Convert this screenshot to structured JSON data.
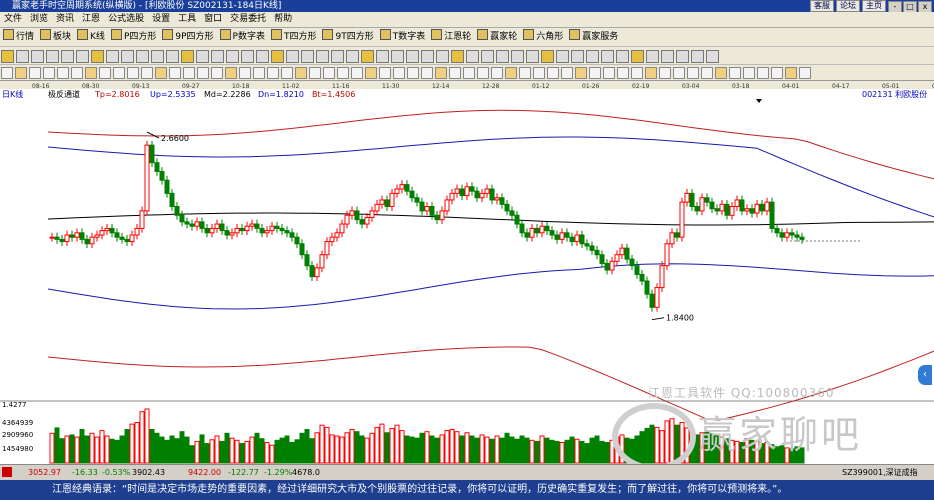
{
  "window": {
    "title": "赢家老手时空周期系统(纵横版) - [利欧股份  SZ002131-184日K线]",
    "sys_buttons": [
      "客服",
      "论坛",
      "主页"
    ],
    "controls": [
      "-",
      "□",
      "x"
    ]
  },
  "menu": [
    "文件",
    "浏览",
    "资讯",
    "江恩",
    "公式选股",
    "设置",
    "工具",
    "窗口",
    "交易委托",
    "帮助"
  ],
  "toolbar1": [
    "行情",
    "板块",
    "K线",
    "P四方形",
    "9P四方形",
    "P数字表",
    "T四方形",
    "9T四方形",
    "T数字表",
    "江恩轮",
    "赢家轮",
    "六角形",
    "赢家服务"
  ],
  "date_ticks": [
    "08-16",
    "08-30",
    "09-13",
    "09-27",
    "10-18",
    "11-02",
    "11-16",
    "11-30",
    "12-14",
    "12-28",
    "01-12",
    "01-26",
    "02-19",
    "03-04",
    "03-18",
    "04-01",
    "04-17",
    "05-01",
    "05-15"
  ],
  "chart_header": {
    "period": "日K线",
    "indicator": "极反通道",
    "tp": "Tp=2.8016",
    "up": "Up=2.5335",
    "md": "Md=2.2286",
    "dn": "Dn=1.8210",
    "bt": "Bt=1.4506",
    "stock": "002131 利欧股份"
  },
  "annotations": {
    "high": "2.6600",
    "low": "1.8400"
  },
  "volume_axis": [
    "1.4277",
    "4364939",
    "2909960",
    "1454980"
  ],
  "watermark": {
    "line1": "江恩工具软件  QQ:100800360",
    "line2": "赢家聊吧"
  },
  "status_bar": {
    "index1": "3052.97",
    "index1_change": "-16.33",
    "index1_pct": "-0.53%",
    "index1_amount": "3902.43",
    "index2": "9422.00",
    "index2_change": "-122.77",
    "index2_pct": "-1.29%",
    "index2_amount": "4678.0",
    "right": "SZ399001,深证成指"
  },
  "quote_bar": "江恩经典语录：“时间是决定市场走势的重要因素，经过详细研究大市及个别股票的过往记录，你将可以证明，历史确实重复发生；而了解过往，你将可以预测将来。”。",
  "colors": {
    "title_bg": "#1a3f9a",
    "up_candle": "#ff0000",
    "down_candle": "#008000",
    "outer_band": "#c02020",
    "inner_band": "#1818b0",
    "mid_line": "#000000"
  },
  "chart_data": {
    "type": "candlestick",
    "ylim": [
      1.4506,
      2.8016
    ],
    "closes": [
      2.18,
      2.17,
      2.16,
      2.19,
      2.18,
      2.2,
      2.17,
      2.15,
      2.18,
      2.19,
      2.21,
      2.22,
      2.2,
      2.18,
      2.17,
      2.16,
      2.19,
      2.22,
      2.3,
      2.6,
      2.52,
      2.48,
      2.44,
      2.38,
      2.32,
      2.28,
      2.25,
      2.24,
      2.23,
      2.25,
      2.22,
      2.2,
      2.22,
      2.24,
      2.21,
      2.19,
      2.2,
      2.22,
      2.21,
      2.23,
      2.24,
      2.22,
      2.2,
      2.21,
      2.23,
      2.22,
      2.21,
      2.2,
      2.18,
      2.15,
      2.1,
      2.05,
      2.0,
      2.04,
      2.1,
      2.16,
      2.18,
      2.2,
      2.24,
      2.28,
      2.3,
      2.26,
      2.24,
      2.27,
      2.3,
      2.33,
      2.35,
      2.32,
      2.38,
      2.4,
      2.42,
      2.39,
      2.36,
      2.34,
      2.3,
      2.32,
      2.28,
      2.26,
      2.3,
      2.35,
      2.38,
      2.4,
      2.37,
      2.41,
      2.39,
      2.36,
      2.38,
      2.4,
      2.35,
      2.36,
      2.33,
      2.3,
      2.28,
      2.24,
      2.2,
      2.18,
      2.22,
      2.2,
      2.23,
      2.21,
      2.19,
      2.17,
      2.2,
      2.18,
      2.16,
      2.19,
      2.15,
      2.14,
      2.12,
      2.1,
      2.06,
      2.03,
      2.07,
      2.1,
      2.13,
      2.08,
      2.05,
      2.01,
      1.98,
      1.92,
      1.86,
      1.95,
      2.05,
      2.15,
      2.2,
      2.18,
      2.34,
      2.38,
      2.32,
      2.3,
      2.36,
      2.34,
      2.31,
      2.3,
      2.33,
      2.28,
      2.32,
      2.35,
      2.3,
      2.31,
      2.29,
      2.33,
      2.3,
      2.34,
      2.22,
      2.2,
      2.18,
      2.2,
      2.19,
      2.18,
      2.17
    ],
    "volumes": [
      0.55,
      0.65,
      0.45,
      0.5,
      0.52,
      0.48,
      0.62,
      0.5,
      0.55,
      0.48,
      0.6,
      0.5,
      0.44,
      0.42,
      0.5,
      0.62,
      0.72,
      0.75,
      0.95,
      1.0,
      0.62,
      0.55,
      0.48,
      0.42,
      0.5,
      0.45,
      0.58,
      0.48,
      0.32,
      0.4,
      0.52,
      0.36,
      0.43,
      0.5,
      0.4,
      0.55,
      0.46,
      0.42,
      0.36,
      0.4,
      0.48,
      0.55,
      0.45,
      0.38,
      0.33,
      0.42,
      0.46,
      0.5,
      0.38,
      0.43,
      0.55,
      0.62,
      0.45,
      0.56,
      0.7,
      0.66,
      0.52,
      0.5,
      0.48,
      0.56,
      0.62,
      0.58,
      0.5,
      0.46,
      0.55,
      0.66,
      0.72,
      0.56,
      0.64,
      0.7,
      0.6,
      0.5,
      0.48,
      0.46,
      0.55,
      0.58,
      0.5,
      0.46,
      0.52,
      0.6,
      0.62,
      0.58,
      0.5,
      0.56,
      0.5,
      0.46,
      0.52,
      0.48,
      0.44,
      0.5,
      0.46,
      0.55,
      0.48,
      0.44,
      0.5,
      0.46,
      0.42,
      0.4,
      0.5,
      0.46,
      0.42,
      0.4,
      0.38,
      0.42,
      0.48,
      0.44,
      0.4,
      0.36,
      0.46,
      0.5,
      0.4,
      0.38,
      0.42,
      0.48,
      0.52,
      0.46,
      0.44,
      0.5,
      0.58,
      0.64,
      0.7,
      0.66,
      0.6,
      0.78,
      0.82,
      0.7,
      0.75,
      0.65,
      0.58,
      0.52,
      0.56,
      0.6,
      0.54,
      0.5,
      0.48,
      0.45,
      0.42,
      0.4,
      0.38,
      0.45,
      0.42,
      0.4,
      0.36,
      0.38,
      0.34,
      0.3,
      0.32,
      0.28,
      0.26,
      0.3,
      0.28
    ]
  }
}
